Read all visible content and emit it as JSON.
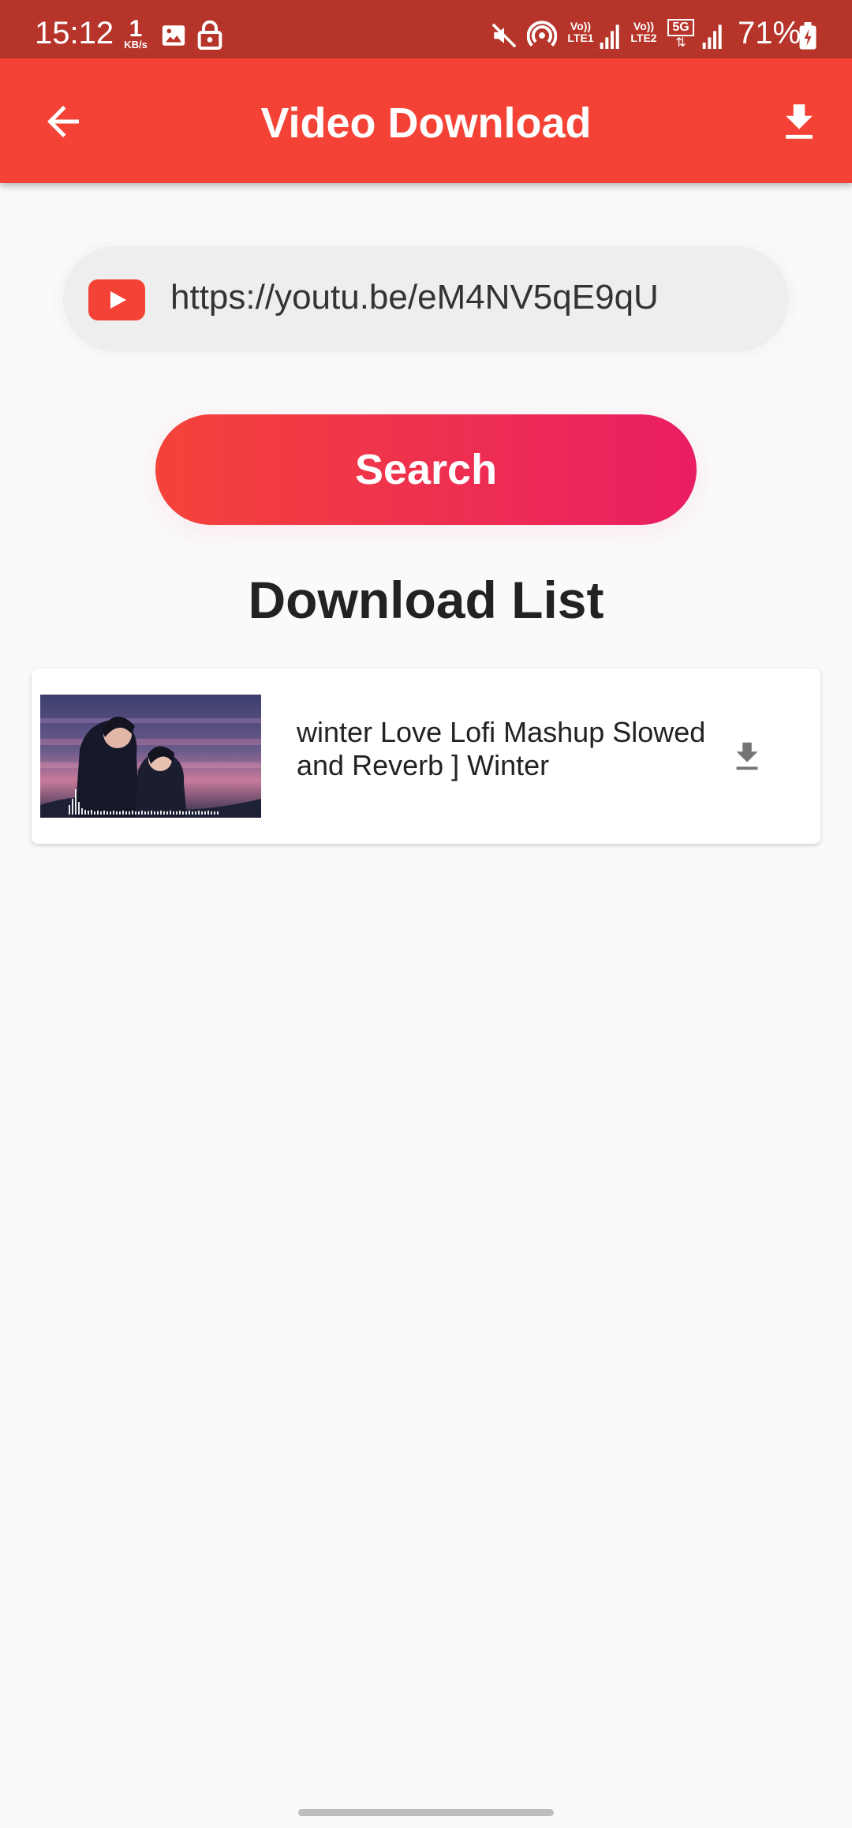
{
  "status_bar": {
    "time": "15:12",
    "net_speed_value": "1",
    "net_speed_unit": "KB/s",
    "lte1": "LTE1",
    "lte2": "LTE2",
    "volte": "Vo))",
    "net_type": "5G",
    "battery": "71%"
  },
  "app_bar": {
    "title": "Video Download"
  },
  "url_field": {
    "value": "https://youtu.be/eM4NV5qE9qU"
  },
  "search_button": {
    "label": "Search"
  },
  "download_list": {
    "title": "Download List",
    "items": [
      {
        "title": "winter Love Lofi Mashup Slowed and Reverb ] Winter"
      }
    ]
  },
  "colors": {
    "status_bar": "#b6342a",
    "app_bar": "#f44336",
    "gradient_start": "#f4433a",
    "gradient_end": "#e91e63",
    "youtube_red": "#f44336"
  }
}
